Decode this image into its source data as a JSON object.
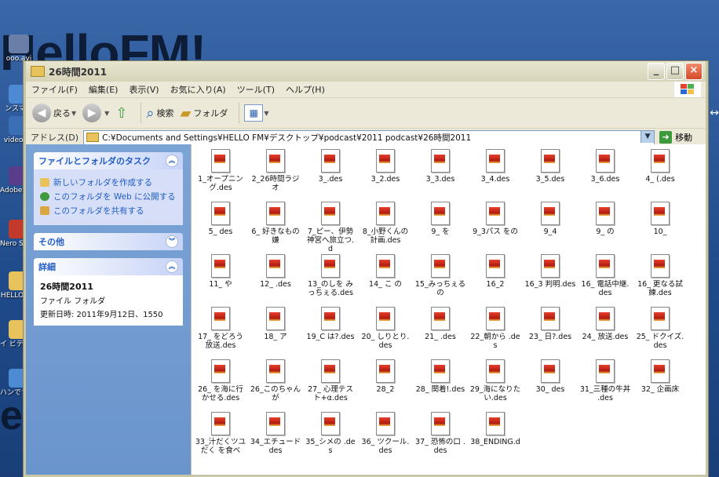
{
  "desktop": {
    "wallpaper_text": "HelloFM!",
    "wallpaper_text2": "etc",
    "icons": [
      {
        "label": "ooo.avi",
        "color": "#6a7fa8"
      },
      {
        "label": "ンスマー",
        "color": "#4c8ad3"
      },
      {
        "label": "video.av",
        "color": "#3b6fb5"
      },
      {
        "label": "Adobe emiere El",
        "color": "#5a3c8c"
      },
      {
        "label": "Nero StartSma",
        "color": "#c43a2a"
      },
      {
        "label": "HELLO CM",
        "color": "#e8c25a"
      },
      {
        "label": "イ ビデオ ヘ ショートカット",
        "color": "#e8c25a"
      },
      {
        "label": "ハンですどav",
        "color": "#4c8ad3"
      }
    ]
  },
  "window": {
    "title": "26時間2011",
    "menu": [
      "ファイル(F)",
      "編集(E)",
      "表示(V)",
      "お気に入り(A)",
      "ツール(T)",
      "ヘルプ(H)"
    ],
    "toolbar": {
      "back": "戻る",
      "search": "検索",
      "folders": "フォルダ"
    },
    "address": {
      "label": "アドレス(D)",
      "value": "C:¥Documents and Settings¥HELLO FM¥デスクトップ¥podcast¥2011 podcast¥26時間2011",
      "go": "移動"
    }
  },
  "taskpane": {
    "tasks": {
      "title": "ファイルとフォルダのタスク",
      "links": [
        "新しいフォルダを作成する",
        "このフォルダを Web に公開する",
        "このフォルダを共有する"
      ]
    },
    "other": {
      "title": "その他"
    },
    "details": {
      "title": "詳細",
      "name": "26時間2011",
      "type": "ファイル フォルダ",
      "updated": "更新日時: 2011年9月12日、1550"
    }
  },
  "files": [
    [
      "1_オープニング.des",
      "2_26時間ラジオ",
      "3_.des",
      "3_2.des",
      "3_3.des",
      "3_4.des",
      "3_5.des",
      "3_6.des",
      "4_ (.des"
    ],
    [
      "5_ des",
      "6_ 好きなもの嫌",
      "7_ピー、伊勢神宮へ旅立つ.d",
      "8_小野くんの計画.des",
      "9_ を",
      "9_3パス をの",
      "9_4",
      "9_ の",
      "10_"
    ],
    [
      "11_ や",
      "12_ .des",
      "13_のしを みっちぇる.des",
      "14_ こ の",
      "15_みっちぇるの",
      "16_2",
      "16_3 判明.des",
      "16_ 電話中継.des",
      "16_ 更なる試練.des"
    ],
    [
      "17_ をどろう放送.des",
      "18_ ア",
      "19_C は?.des",
      "20_ しりとり.des",
      "21_ .des",
      "22_朝から .des",
      "23_ 日?.des",
      "24_ 放送.des",
      "25_ ドクイズ.des"
    ],
    [
      "26_ を海に行かせる.des",
      "26_このちゃんが",
      "27_ 心理テスト+α.des",
      "28_2",
      "28_ 関着!.des",
      "29_海になりたい.des",
      "30_ des",
      "31_三種の牛丼 .des",
      "32_ 企画床"
    ],
    [
      "33_汁だくツユだく を食べ",
      "34_エチュード des",
      "35_シメの .des",
      "36_ ツクール.des",
      "37_ 恐怖の口 .des",
      "38_ENDING.d"
    ]
  ]
}
